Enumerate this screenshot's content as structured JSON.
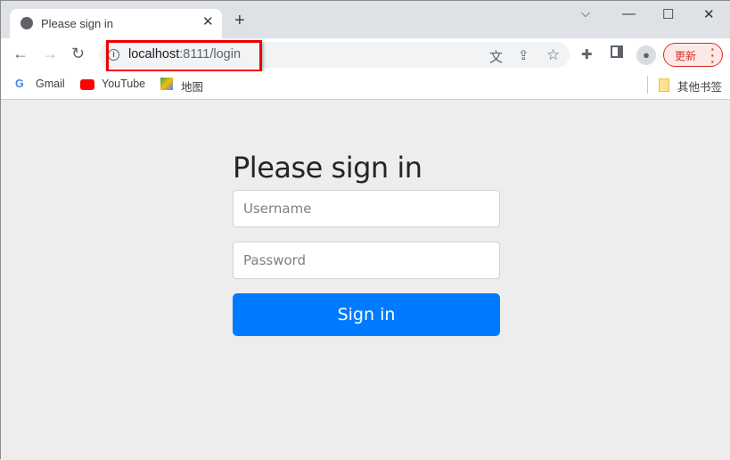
{
  "tab": {
    "title": "Please sign in",
    "icon": "globe-icon"
  },
  "toolbar": {
    "url_host": "localhost",
    "url_rest": ":8111/login",
    "update_label": "更新"
  },
  "bookmarks": [
    {
      "label": "Gmail"
    },
    {
      "label": "YouTube"
    },
    {
      "label": "地图"
    }
  ],
  "other_bookmarks": "其他书签",
  "form": {
    "heading": "Please sign in",
    "username_placeholder": "Username",
    "password_placeholder": "Password",
    "submit_label": "Sign in"
  },
  "colors": {
    "primary": "#007bff",
    "highlight": "#e00000",
    "background": "#ededed"
  }
}
